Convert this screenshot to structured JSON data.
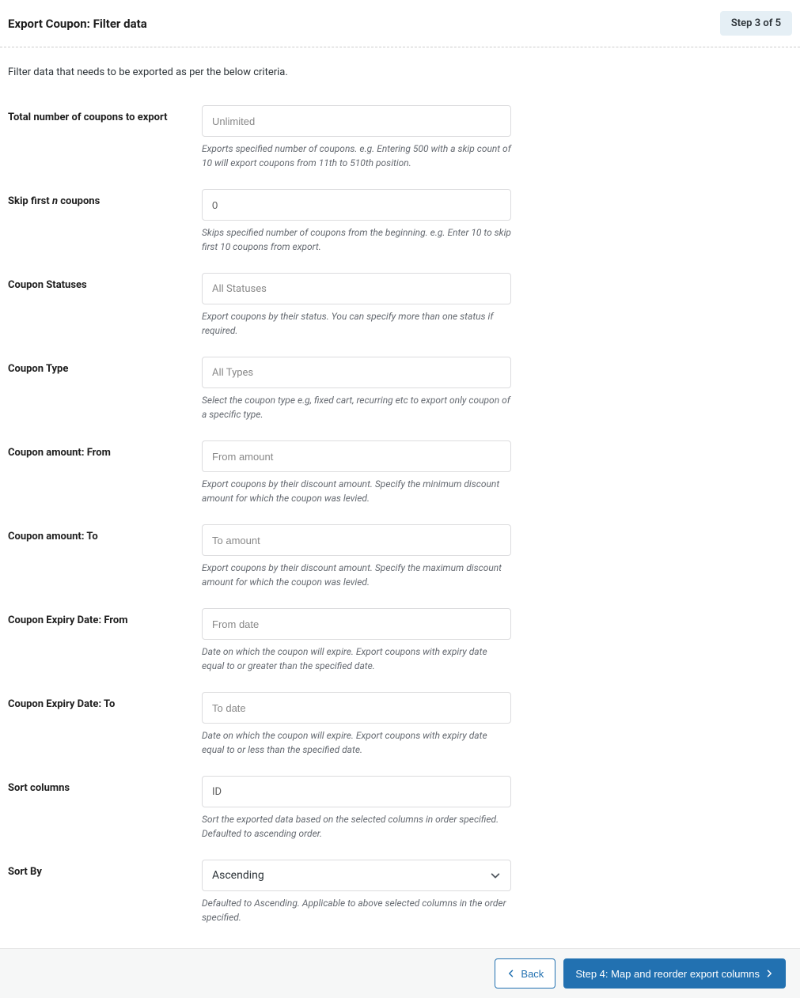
{
  "header": {
    "title": "Export Coupon: Filter data",
    "step": "Step 3 of 5"
  },
  "intro": "Filter data that needs to be exported as per the below criteria.",
  "fields": {
    "total": {
      "label": "Total number of coupons to export",
      "placeholder": "Unlimited",
      "value": "",
      "help": "Exports specified number of coupons. e.g. Entering 500 with a skip count of 10 will export coupons from 11th to 510th position."
    },
    "skip": {
      "label_pre": "Skip first ",
      "label_em": "n",
      "label_post": " coupons",
      "value": "0",
      "help": "Skips specified number of coupons from the beginning. e.g. Enter 10 to skip first 10 coupons from export."
    },
    "statuses": {
      "label": "Coupon Statuses",
      "placeholder": "All Statuses",
      "help": "Export coupons by their status. You can specify more than one status if required."
    },
    "type": {
      "label": "Coupon Type",
      "placeholder": "All Types",
      "help": "Select the coupon type e.g, fixed cart, recurring etc to export only coupon of a specific type."
    },
    "amount_from": {
      "label": "Coupon amount: From",
      "placeholder": "From amount",
      "value": "",
      "help": "Export coupons by their discount amount. Specify the minimum discount amount for which the coupon was levied."
    },
    "amount_to": {
      "label": "Coupon amount: To",
      "placeholder": "To amount",
      "value": "",
      "help": "Export coupons by their discount amount. Specify the maximum discount amount for which the coupon was levied."
    },
    "expiry_from": {
      "label": "Coupon Expiry Date: From",
      "placeholder": "From date",
      "value": "",
      "help": "Date on which the coupon will expire. Export coupons with expiry date equal to or greater than the specified date."
    },
    "expiry_to": {
      "label": "Coupon Expiry Date: To",
      "placeholder": "To date",
      "value": "",
      "help": "Date on which the coupon will expire. Export coupons with expiry date equal to or less than the specified date."
    },
    "sort_columns": {
      "label": "Sort columns",
      "value": "ID",
      "help": "Sort the exported data based on the selected columns in order specified. Defaulted to ascending order."
    },
    "sort_by": {
      "label": "Sort By",
      "value": "Ascending",
      "help": "Defaulted to Ascending. Applicable to above selected columns in the order specified."
    }
  },
  "footer": {
    "back": "Back",
    "next": "Step 4: Map and reorder export columns"
  }
}
